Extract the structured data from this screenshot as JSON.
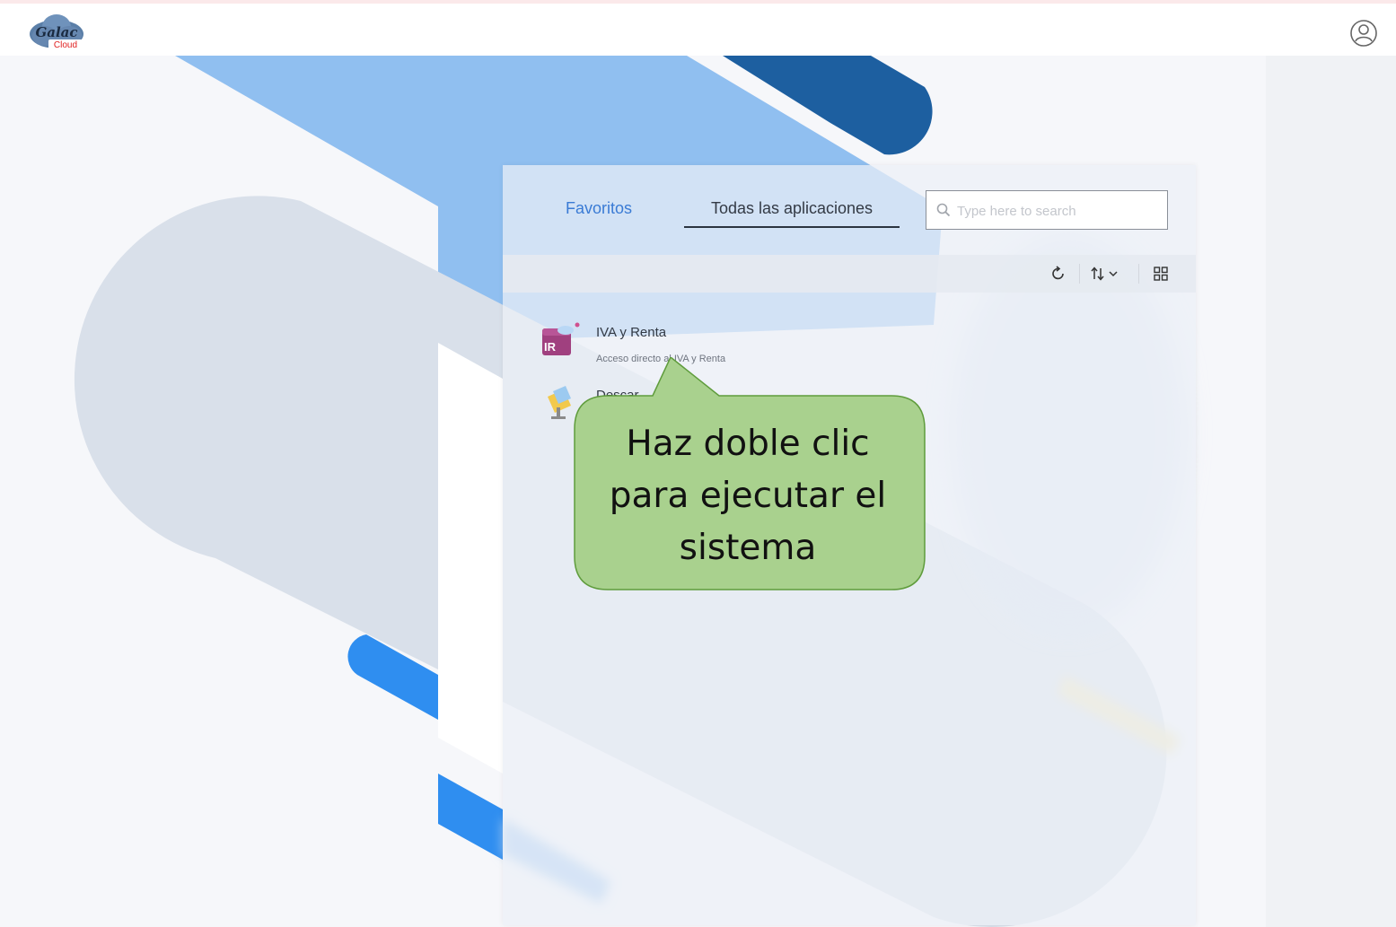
{
  "header": {
    "logo_text_top": "Galac",
    "logo_text_bottom": "Cloud",
    "user_icon": "user-circle-icon"
  },
  "tabs": [
    {
      "label": "Favoritos",
      "active": false
    },
    {
      "label": "Todas las aplicaciones",
      "active": true
    }
  ],
  "search": {
    "placeholder": "Type here to search",
    "value": "",
    "icon": "search-icon"
  },
  "toolbar": {
    "refresh_icon": "refresh-icon",
    "sort_icon": "sort-icon",
    "view_icon": "grid-view-icon"
  },
  "apps": [
    {
      "name": "IVA y Renta",
      "description": "Acceso directo al IVA y Renta",
      "icon": "iva-renta-app-icon"
    },
    {
      "name": "Descar",
      "description": "",
      "icon": "download-app-icon"
    }
  ],
  "callout": {
    "text": "Haz doble clic para ejecutar el sistema"
  },
  "colors": {
    "accent": "#3a7bd5",
    "callout_fill": "#a9d18e",
    "callout_border": "#5f9c3c",
    "shape_light_blue": "#90bff0",
    "shape_dark_blue": "#1d5fa0",
    "shape_bright_blue": "#2f8ef0"
  }
}
